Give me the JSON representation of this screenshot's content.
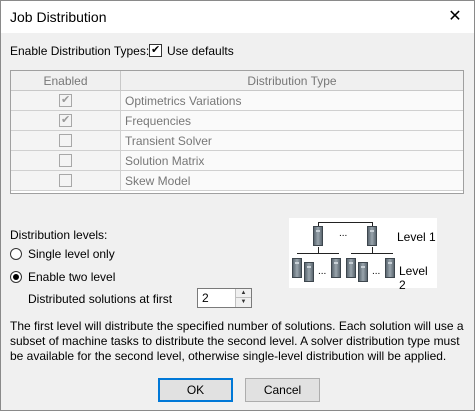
{
  "window": {
    "title": "Job Distribution",
    "close_glyph": "✕"
  },
  "enable_types": {
    "label": "Enable Distribution Types:",
    "use_defaults_label": "Use defaults",
    "use_defaults_checked": true
  },
  "table": {
    "headers": [
      "Enabled",
      "Distribution Type"
    ],
    "rows": [
      {
        "enabled": true,
        "type": "Optimetrics Variations"
      },
      {
        "enabled": true,
        "type": "Frequencies"
      },
      {
        "enabled": false,
        "type": "Transient Solver"
      },
      {
        "enabled": false,
        "type": "Solution Matrix"
      },
      {
        "enabled": false,
        "type": "Skew Model"
      }
    ]
  },
  "levels": {
    "label": "Distribution levels:",
    "single_label": "Single level only",
    "two_label": "Enable two level",
    "selected": "two",
    "first_label": "Distributed solutions at first",
    "first_value": "2"
  },
  "diagram": {
    "level1": "Level 1",
    "level2": "Level 2",
    "ellipsis": "..."
  },
  "description": "The first level will distribute the specified number of solutions. Each solution will use a subset of machine tasks to distribute the second level. A solver distribution type must be available for the second level, otherwise single-level distribution will be applied.",
  "buttons": {
    "ok": "OK",
    "cancel": "Cancel"
  },
  "icons": [
    "close-icon",
    "checkmark-icon",
    "server-icon",
    "spin-up-icon",
    "spin-down-icon"
  ]
}
